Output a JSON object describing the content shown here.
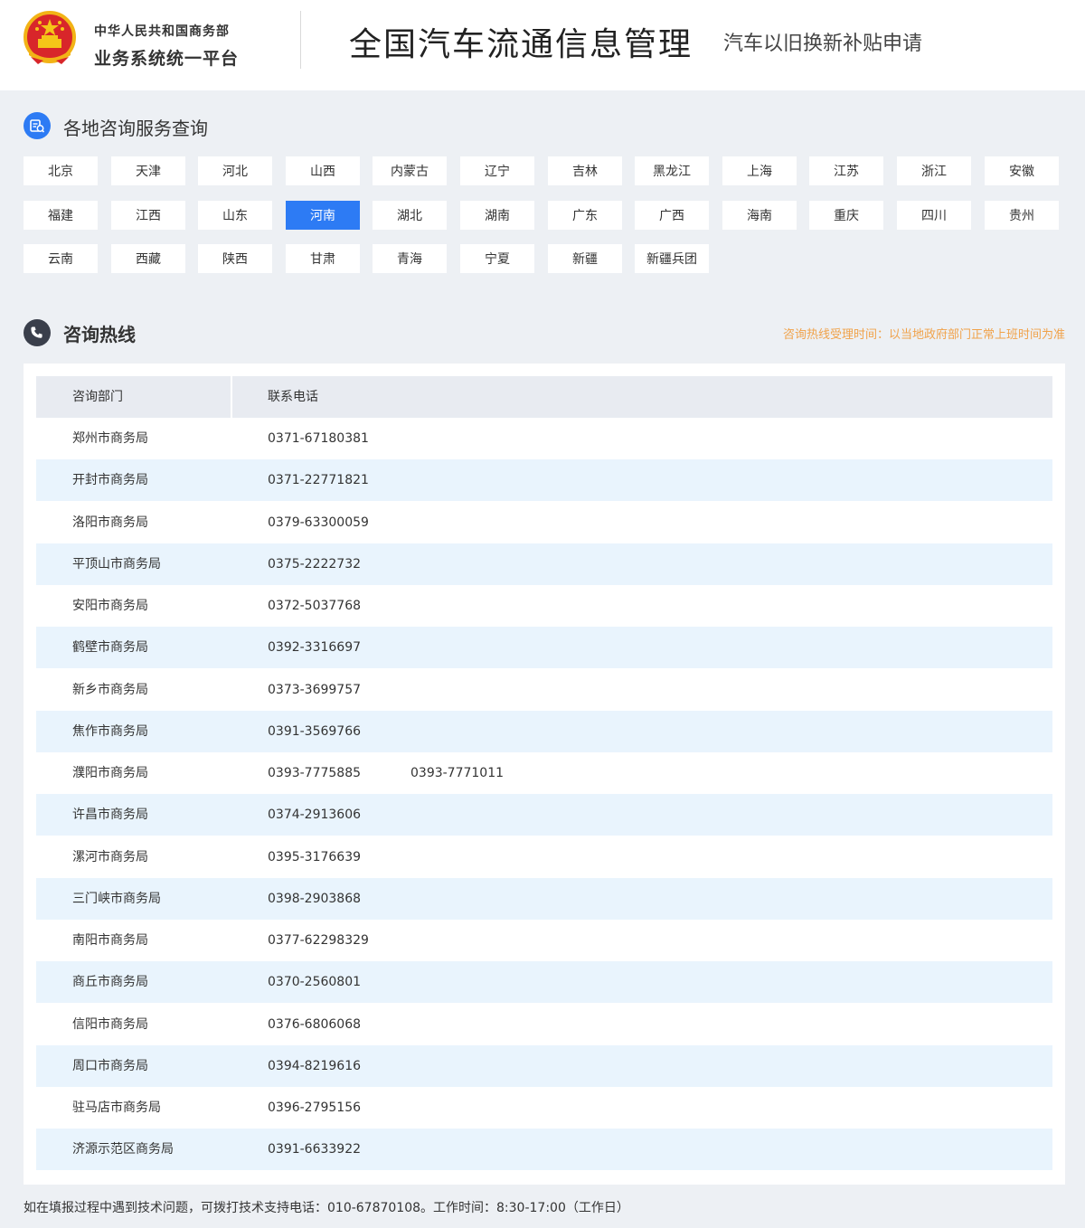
{
  "header": {
    "org_line1": "中华人民共和国商务部",
    "org_line2": "业务系统统一平台",
    "main_title": "全国汽车流通信息管理",
    "sub_title": "汽车以旧换新补贴申请"
  },
  "regions": {
    "title": "各地咨询服务查询",
    "selected": "河南",
    "items": [
      "北京",
      "天津",
      "河北",
      "山西",
      "内蒙古",
      "辽宁",
      "吉林",
      "黑龙江",
      "上海",
      "江苏",
      "浙江",
      "安徽",
      "福建",
      "江西",
      "山东",
      "河南",
      "湖北",
      "湖南",
      "广东",
      "广西",
      "海南",
      "重庆",
      "四川",
      "贵州",
      "云南",
      "西藏",
      "陕西",
      "甘肃",
      "青海",
      "宁夏",
      "新疆",
      "新疆兵团"
    ]
  },
  "hotline": {
    "title": "咨询热线",
    "notice": "咨询热线受理时间：以当地政府部门正常上班时间为准",
    "columns": [
      "咨询部门",
      "联系电话"
    ],
    "rows": [
      {
        "dept": "郑州市商务局",
        "phone1": "0371-67180381",
        "phone2": ""
      },
      {
        "dept": "开封市商务局",
        "phone1": "0371-22771821",
        "phone2": ""
      },
      {
        "dept": "洛阳市商务局",
        "phone1": "0379-63300059",
        "phone2": ""
      },
      {
        "dept": "平顶山市商务局",
        "phone1": "0375-2222732",
        "phone2": ""
      },
      {
        "dept": "安阳市商务局",
        "phone1": "0372-5037768",
        "phone2": ""
      },
      {
        "dept": "鹤壁市商务局",
        "phone1": "0392-3316697",
        "phone2": ""
      },
      {
        "dept": "新乡市商务局",
        "phone1": "0373-3699757",
        "phone2": ""
      },
      {
        "dept": "焦作市商务局",
        "phone1": "0391-3569766",
        "phone2": ""
      },
      {
        "dept": "濮阳市商务局",
        "phone1": "0393-7775885",
        "phone2": "0393-7771011"
      },
      {
        "dept": "许昌市商务局",
        "phone1": "0374-2913606",
        "phone2": ""
      },
      {
        "dept": "漯河市商务局",
        "phone1": "0395-3176639",
        "phone2": ""
      },
      {
        "dept": "三门峡市商务局",
        "phone1": "0398-2903868",
        "phone2": ""
      },
      {
        "dept": "南阳市商务局",
        "phone1": "0377-62298329",
        "phone2": ""
      },
      {
        "dept": "商丘市商务局",
        "phone1": "0370-2560801",
        "phone2": ""
      },
      {
        "dept": "信阳市商务局",
        "phone1": "0376-6806068",
        "phone2": ""
      },
      {
        "dept": "周口市商务局",
        "phone1": "0394-8219616",
        "phone2": ""
      },
      {
        "dept": "驻马店市商务局",
        "phone1": "0396-2795156",
        "phone2": ""
      },
      {
        "dept": "济源示范区商务局",
        "phone1": "0391-6633922",
        "phone2": ""
      }
    ]
  },
  "footer": {
    "note": "如在填报过程中遇到技术问题，可拨打技术支持电话：010-67870108。工作时间：8:30-17:00（工作日）"
  },
  "colors": {
    "accent": "#2d7bf4",
    "notice": "#f0a24a",
    "row_alt": "#e9f4fd",
    "header_row": "#e8ebf1",
    "page_bg": "#edf0f4"
  }
}
